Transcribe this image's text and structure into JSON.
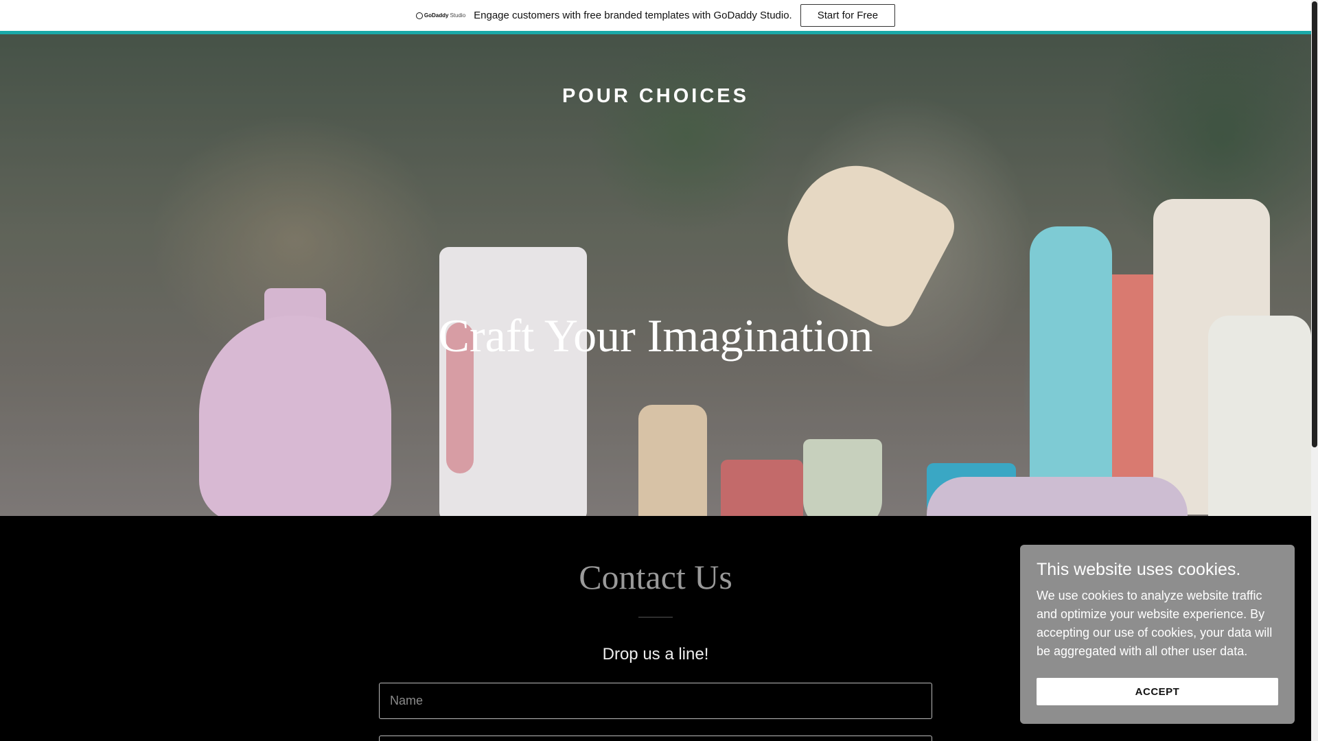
{
  "promo": {
    "logo_brand": "GoDaddy",
    "logo_product": "Studio",
    "text": "Engage customers with free branded templates with GoDaddy Studio.",
    "button_label": "Start for Free",
    "accent_color": "#1aa8a8"
  },
  "hero": {
    "brand": "POUR CHOICES",
    "title": "Craft Your Imagination"
  },
  "contact": {
    "title": "Contact Us",
    "subtitle": "Drop us a line!",
    "name_placeholder": "Name",
    "email_placeholder": ""
  },
  "cookie": {
    "title": "This website uses cookies.",
    "body": "We use cookies to analyze website traffic and optimize your website experience. By accepting our use of cookies, your data will be aggregated with all other user data.",
    "accept_label": "ACCEPT"
  }
}
